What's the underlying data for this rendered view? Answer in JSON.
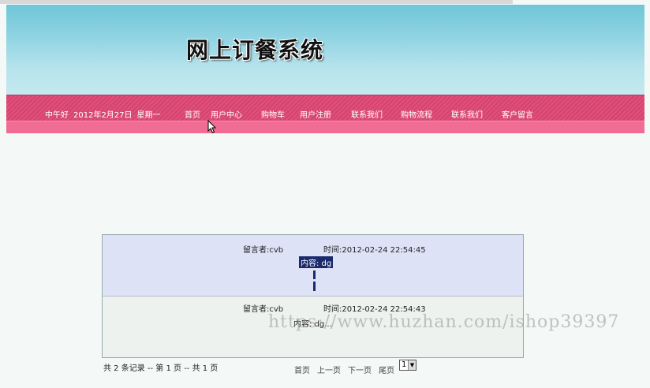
{
  "header": {
    "site_title": "网上订餐系统",
    "greeting": "中午好",
    "date": "2012年2月27日",
    "weekday": "星期一"
  },
  "nav": {
    "items": [
      {
        "label": "首页"
      },
      {
        "label": "用户中心"
      },
      {
        "label": "购物车"
      },
      {
        "label": "用户注册"
      },
      {
        "label": "联系我们"
      },
      {
        "label": "购物流程"
      },
      {
        "label": "联系我们"
      },
      {
        "label": "客户留言"
      }
    ]
  },
  "messages": [
    {
      "author": "留言者:cvb",
      "time": "时间:2012-02-24 22:54:45",
      "content": "内容: dg"
    },
    {
      "author": "留言者:cvb",
      "time": "时间:2012-02-24 22:54:43",
      "content": "内容: dg..."
    }
  ],
  "pagination": {
    "record_info": "共 2 条记录 -- 第 1 页 -- 共 1 页",
    "first": "首页",
    "prev": "上一页",
    "next": "下一页",
    "last": "尾页",
    "selected_page": "1"
  },
  "watermark": "https://www.huzhan.com/ishop39397",
  "colors": {
    "banner_top": "#6fc6d8",
    "nav_pink": "#e0507a",
    "nav_sub_pink": "#f06c94",
    "message_highlight": "#dde2f6",
    "selection_navy": "#1a2a6c"
  }
}
